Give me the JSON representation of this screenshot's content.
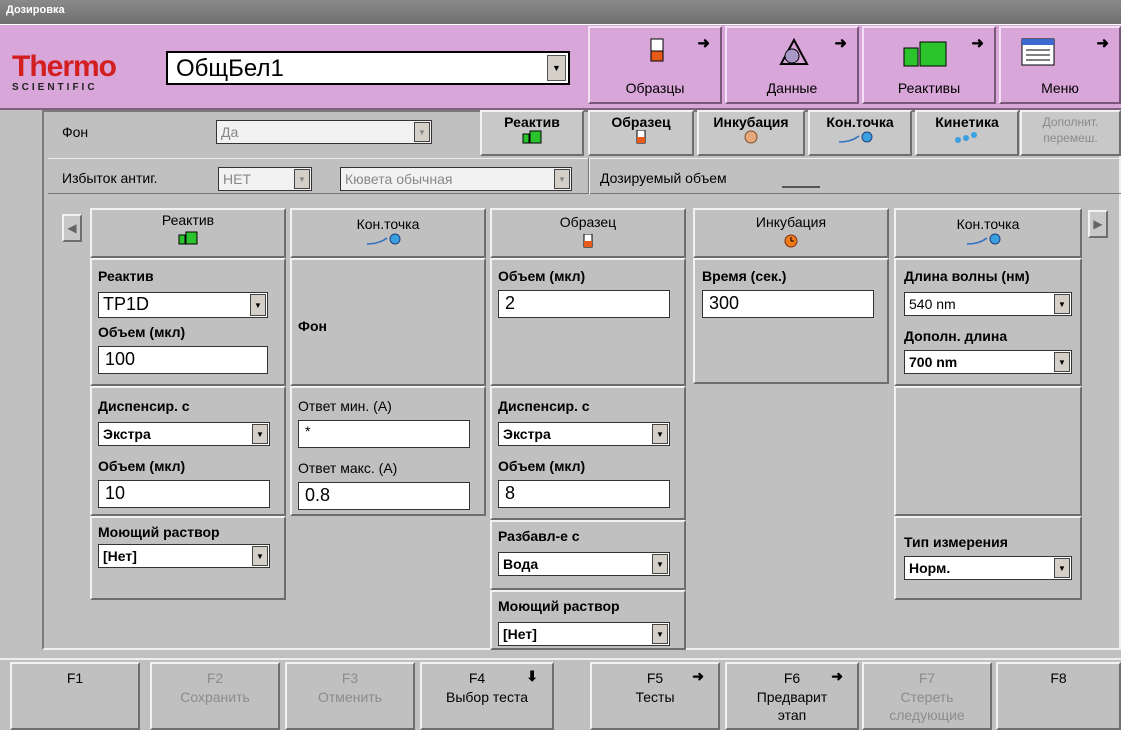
{
  "window": {
    "title": "Дозировка"
  },
  "logo": {
    "brand": "Thermo",
    "sub": "SCIENTIFIC"
  },
  "test_select": {
    "value": "ОбщБел1"
  },
  "nav_buttons": [
    {
      "label": "Образцы",
      "icon": "tube-icon"
    },
    {
      "label": "Данные",
      "icon": "data-icon"
    },
    {
      "label": "Реактивы",
      "icon": "reagent-icon"
    },
    {
      "label": "Меню",
      "icon": "menu-icon"
    }
  ],
  "settings": {
    "background_label": "Фон",
    "background_value": "Да",
    "excess_label": "Избыток антиг.",
    "excess_value": "НЕТ",
    "cuvette_value": "Кювета обычная",
    "dosed_volume_label": "Дозируемый объем"
  },
  "step_buttons": [
    {
      "label": "Реактив"
    },
    {
      "label": "Образец"
    },
    {
      "label": "Инкубация"
    },
    {
      "label": "Кон.точка"
    },
    {
      "label": "Кинетика"
    },
    {
      "label": "Дополнит. перемеш."
    }
  ],
  "columns": {
    "reagent": {
      "header": "Реактив",
      "reagent_label": "Реактив",
      "reagent_value": "TP1D",
      "volume_label": "Объем (мкл)",
      "volume_value": "100",
      "dispense_label": "Диспенсир. с",
      "dispense_value": "Экстра",
      "volume2_label": "Объем (мкл)",
      "volume2_value": "10",
      "wash_label": "Моющий раствор",
      "wash_value": "[Нет]"
    },
    "endpoint1": {
      "header": "Кон.точка",
      "text": "Фон",
      "min_label": "Ответ мин. (А)",
      "min_value": "*",
      "max_label": "Ответ макс. (А)",
      "max_value": "0.8"
    },
    "sample": {
      "header": "Образец",
      "volume_label": "Объем (мкл)",
      "volume_value": "2",
      "dispense_label": "Диспенсир. с",
      "dispense_value": "Экстра",
      "volume2_label": "Объем (мкл)",
      "volume2_value": "8",
      "dilute_label": "Разбавл-е с",
      "dilute_value": "Вода",
      "wash_label": "Моющий раствор",
      "wash_value": "[Нет]"
    },
    "incubation": {
      "header": "Инкубация",
      "time_label": "Время (сек.)",
      "time_value": "300"
    },
    "endpoint2": {
      "header": "Кон.точка",
      "wavelength_label": "Длина волны (нм)",
      "wavelength_value": "540 nm",
      "wavelength2_label": "Дополн. длина",
      "wavelength2_value": "700 nm",
      "measure_label": "Тип измерения",
      "measure_value": "Норм."
    }
  },
  "fkeys": [
    {
      "num": "F1",
      "label": ""
    },
    {
      "num": "F2",
      "label": "Сохранить"
    },
    {
      "num": "F3",
      "label": "Отменить"
    },
    {
      "num": "F4",
      "label": "Выбор теста"
    },
    {
      "num": "F5",
      "label": "Тесты"
    },
    {
      "num": "F6",
      "label": "Предварит этап"
    },
    {
      "num": "F7",
      "label": "Стереть следующие"
    },
    {
      "num": "F8",
      "label": ""
    }
  ],
  "colors": {
    "accent": "#d9a6d9",
    "brand_red": "#d31f1f",
    "panel": "#c0c0c0"
  }
}
